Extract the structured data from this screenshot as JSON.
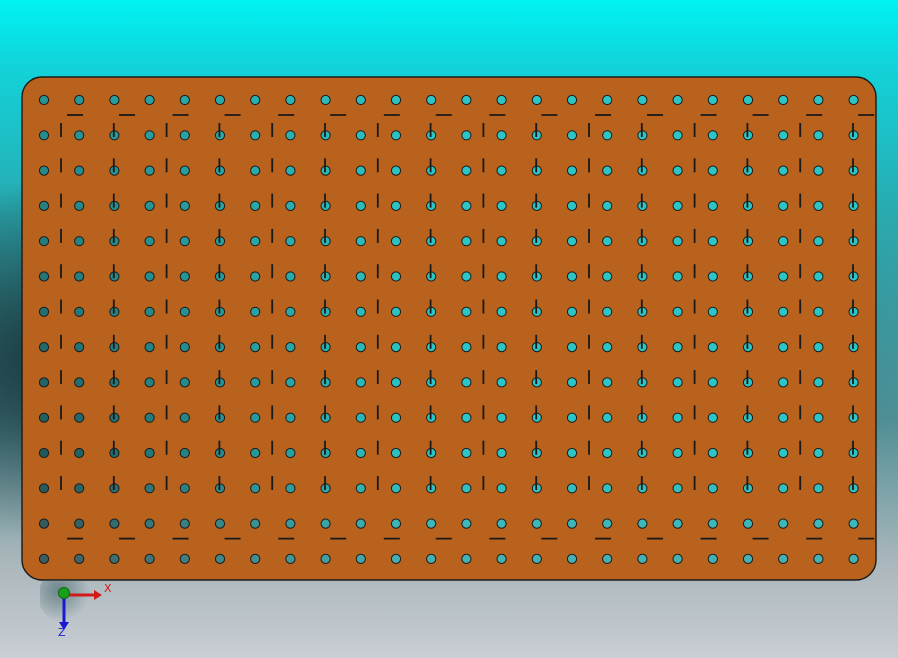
{
  "app": {
    "view": "cad-viewport"
  },
  "part": {
    "name": "perforated-plate",
    "color": "#b8621e",
    "edge_color": "#1a1a1a",
    "hole_grid": {
      "columns": 24,
      "rows": 14
    },
    "slot_grid": {
      "columns": 8,
      "rows": 4
    }
  },
  "triad": {
    "x_label": "X",
    "z_label": "Z",
    "x_color": "#d21a1a",
    "y_color": "#18a018",
    "z_color": "#1a1ad2"
  },
  "background": {
    "top": "#00f2f2",
    "bottom": "#c9ced3"
  }
}
